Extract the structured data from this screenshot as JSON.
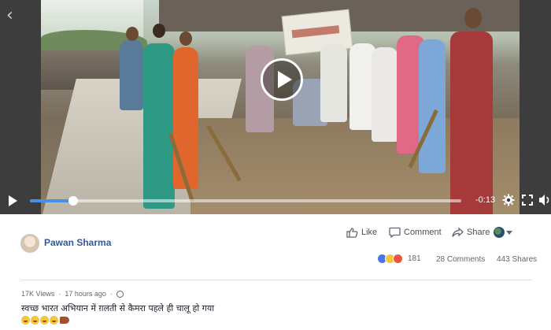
{
  "video": {
    "time_remaining": "-0:13",
    "progress_fraction": 0.1
  },
  "post": {
    "author": "Pawan Sharma",
    "actions": {
      "like": "Like",
      "comment": "Comment",
      "share": "Share"
    },
    "reaction_count": "181",
    "comments": "28 Comments",
    "shares": "443 Shares",
    "views": "17K Views",
    "time": "17 hours ago",
    "caption": "स्वच्छ भारत अभियान में ग़लती से कैमरा पहले ही चालू हो गया"
  },
  "colors": {
    "author_link": "#365899",
    "progress": "#4a90e2",
    "like_reaction": "#4a76e8",
    "laugh_reaction": "#f7c538",
    "angry_reaction": "#e9573f"
  },
  "icons": [
    "back-chevron-icon",
    "play-icon",
    "settings-gear-icon",
    "fullscreen-icon",
    "volume-icon",
    "like-thumb-icon",
    "comment-bubble-icon",
    "share-arrow-icon",
    "globe-icon"
  ]
}
